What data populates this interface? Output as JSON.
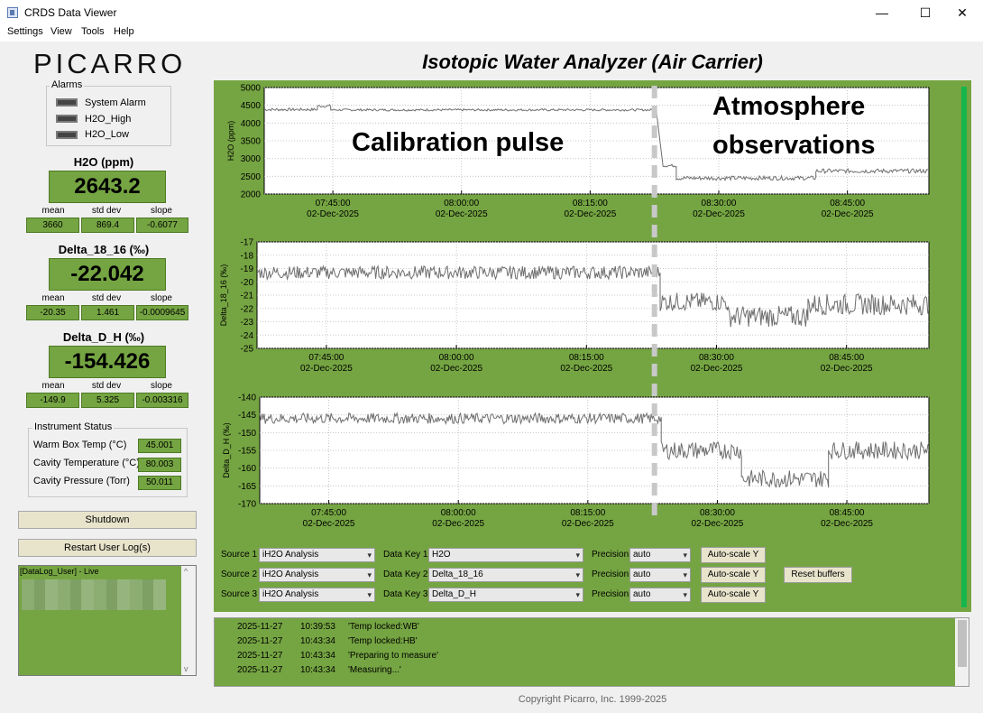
{
  "window": {
    "title": "CRDS Data Viewer",
    "controls": {
      "minimize": "—",
      "maximize": "☐",
      "close": "✕"
    }
  },
  "menu": [
    "Settings",
    "View",
    "Tools",
    "Help"
  ],
  "logo": "PICARRO",
  "alarms": {
    "title": "Alarms",
    "items": [
      "System Alarm",
      "H2O_High",
      "H2O_Low"
    ]
  },
  "readouts": [
    {
      "title": "H2O (ppm)",
      "value": "2643.2",
      "mean": "3660",
      "std": "869.4",
      "slope": "-0.6077"
    },
    {
      "title": "Delta_18_16 (‰)",
      "value": "-22.042",
      "mean": "-20.35",
      "std": "1.461",
      "slope": "-0.0009645"
    },
    {
      "title": "Delta_D_H (‰)",
      "value": "-154.426",
      "mean": "-149.9",
      "std": "5.325",
      "slope": "-0.003316"
    }
  ],
  "stat_labels": {
    "mean": "mean",
    "std": "std dev",
    "slope": "slope"
  },
  "instrument_status": {
    "title": "Instrument Status",
    "items": [
      {
        "label": "Warm Box Temp (°C)",
        "value": "45.001"
      },
      {
        "label": "Cavity Temperature (°C)",
        "value": "80.003"
      },
      {
        "label": "Cavity Pressure (Torr)",
        "value": "50.011"
      }
    ]
  },
  "buttons": {
    "shutdown": "Shutdown",
    "restart": "Restart User Log(s)",
    "reset": "Reset buffers",
    "autoscale": "Auto-scale Y"
  },
  "user_log_title": "[DataLog_User] - Live",
  "main_title": "Isotopic Water Analyzer (Air Carrier)",
  "annotations": {
    "left": "Calibration pulse",
    "right_line1": "Atmosphere",
    "right_line2": "observations"
  },
  "chart_data": [
    {
      "type": "line",
      "ylabel": "H2O (ppm)",
      "ylim": [
        2000,
        5000
      ],
      "yticks": [
        2000,
        2500,
        3000,
        3500,
        4000,
        4500,
        5000
      ],
      "x_ticks": [
        "07:45:00",
        "08:00:00",
        "08:15:00",
        "08:30:00",
        "08:45:00"
      ],
      "x_date": "02-Dec-2025",
      "series": [
        {
          "color": "#6e6e6e",
          "segments": [
            {
              "t": [
                0,
                0.08
              ],
              "base": 4380,
              "jitter": 40
            },
            {
              "t": [
                0.08,
                0.1
              ],
              "base": 4480,
              "jitter": 40
            },
            {
              "t": [
                0.1,
                0.59
              ],
              "base": 4370,
              "jitter": 30
            },
            {
              "t": [
                0.6,
                0.62
              ],
              "base": 2800,
              "jitter": 40
            },
            {
              "t": [
                0.62,
                0.83
              ],
              "base": 2450,
              "jitter": 60
            },
            {
              "t": [
                0.83,
                1.0
              ],
              "base": 2650,
              "jitter": 60
            }
          ]
        }
      ],
      "grid": true,
      "event_line": "08:22:30"
    },
    {
      "type": "line",
      "ylabel": "Delta_18_16 (‰)",
      "ylim": [
        -25,
        -17
      ],
      "yticks": [
        -25,
        -24,
        -23,
        -22,
        -21,
        -20,
        -19,
        -18,
        -17
      ],
      "x_ticks": [
        "07:45:00",
        "08:00:00",
        "08:15:00",
        "08:30:00",
        "08:45:00"
      ],
      "x_date": "02-Dec-2025",
      "series": [
        {
          "color": "#6e6e6e",
          "segments": [
            {
              "t": [
                0,
                0.6
              ],
              "base": -19.3,
              "jitter": 0.5
            },
            {
              "t": [
                0.6,
                0.7
              ],
              "base": -21.5,
              "jitter": 0.7
            },
            {
              "t": [
                0.7,
                0.82
              ],
              "base": -22.6,
              "jitter": 0.8
            },
            {
              "t": [
                0.82,
                1.0
              ],
              "base": -21.7,
              "jitter": 0.8
            }
          ]
        }
      ],
      "grid": true,
      "event_line": "08:22:30"
    },
    {
      "type": "line",
      "ylabel": "Delta_D_H (‰)",
      "ylim": [
        -170,
        -140
      ],
      "yticks": [
        -170,
        -165,
        -160,
        -155,
        -150,
        -145,
        -140
      ],
      "x_ticks": [
        "07:45:00",
        "08:00:00",
        "08:15:00",
        "08:30:00",
        "08:45:00"
      ],
      "x_date": "02-Dec-2025",
      "series": [
        {
          "color": "#6e6e6e",
          "segments": [
            {
              "t": [
                0,
                0.6
              ],
              "base": -146,
              "jitter": 1.5
            },
            {
              "t": [
                0.6,
                0.72
              ],
              "base": -155,
              "jitter": 2.5
            },
            {
              "t": [
                0.72,
                0.85
              ],
              "base": -163,
              "jitter": 2.5
            },
            {
              "t": [
                0.85,
                1.0
              ],
              "base": -155,
              "jitter": 2.5
            }
          ]
        }
      ],
      "grid": true,
      "event_line": "08:22:30"
    }
  ],
  "controls": {
    "rows": [
      {
        "source_label": "Source 1",
        "source": "iH2O Analysis",
        "key_label": "Data Key 1",
        "key": "H2O",
        "precision": "auto"
      },
      {
        "source_label": "Source 2",
        "source": "iH2O Analysis",
        "key_label": "Data Key 2",
        "key": "Delta_18_16",
        "precision": "auto"
      },
      {
        "source_label": "Source 3",
        "source": "iH2O Analysis",
        "key_label": "Data Key 3",
        "key": "Delta_D_H",
        "precision": "auto"
      }
    ],
    "precision_label": "Precision"
  },
  "event_log": [
    {
      "date": "2025-11-27",
      "time": "10:39:53",
      "msg": "'Temp locked:WB'"
    },
    {
      "date": "2025-11-27",
      "time": "10:43:34",
      "msg": "'Temp locked:HB'"
    },
    {
      "date": "2025-11-27",
      "time": "10:43:34",
      "msg": "'Preparing to measure'"
    },
    {
      "date": "2025-11-27",
      "time": "10:43:34",
      "msg": "'Measuring...'"
    }
  ],
  "copyright": "Copyright Picarro, Inc. 1999-2025"
}
